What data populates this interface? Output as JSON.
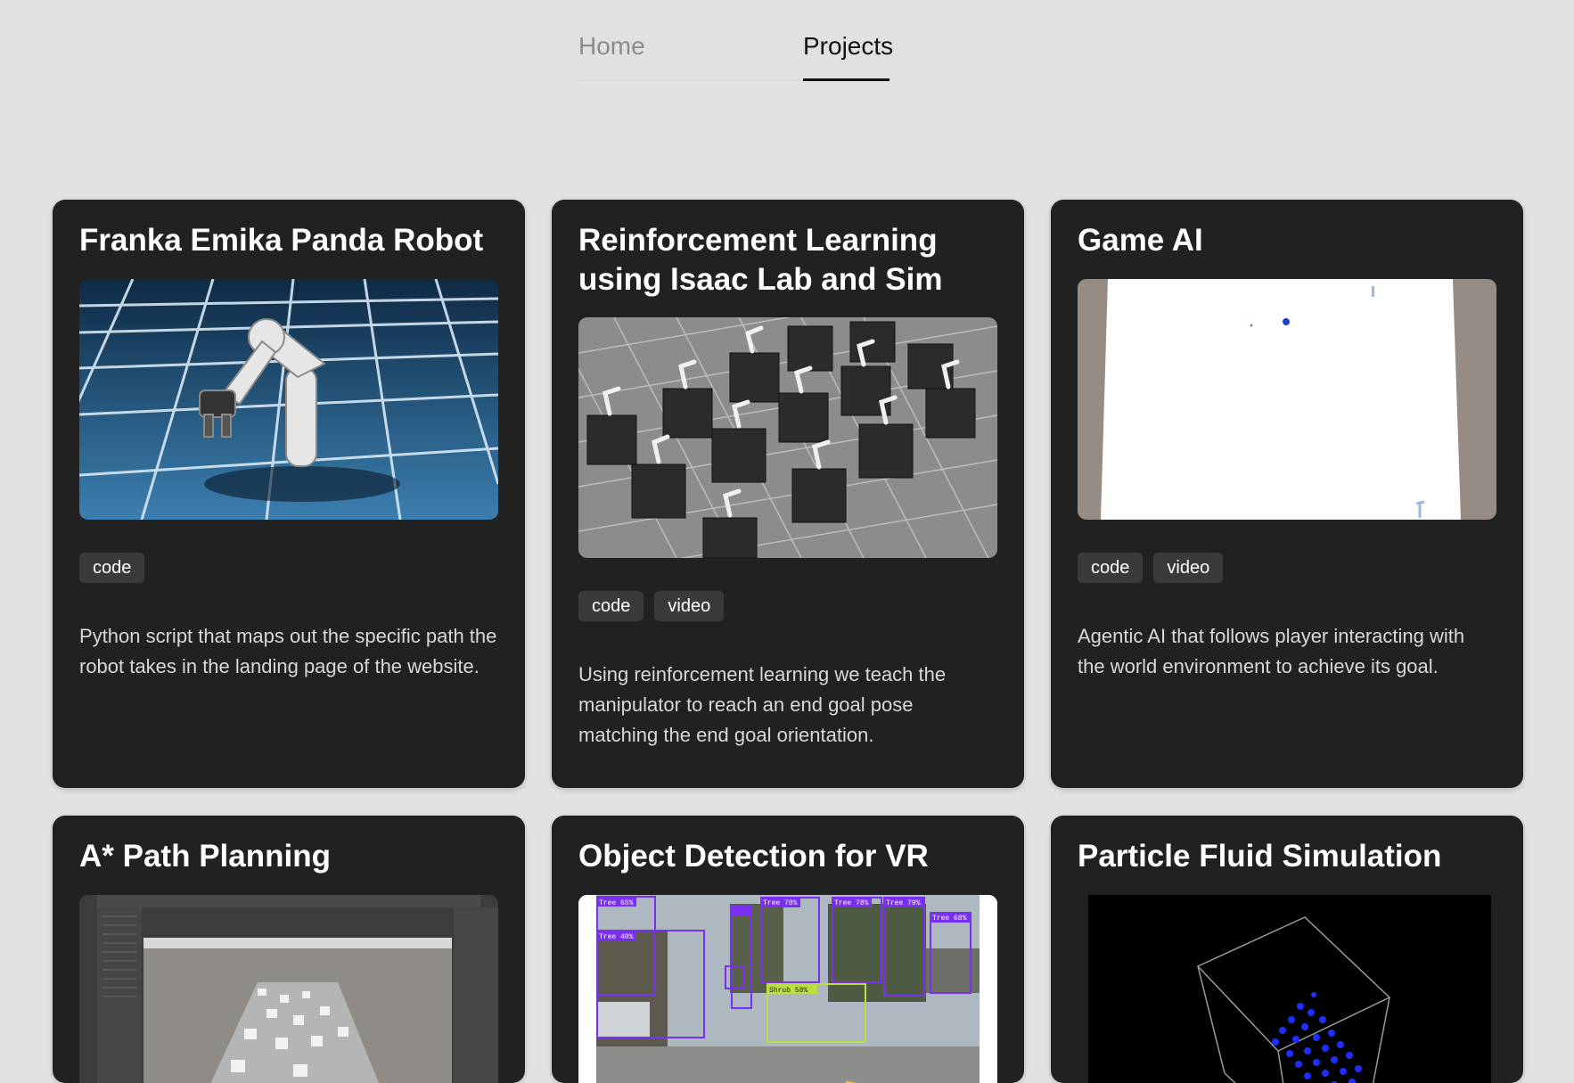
{
  "nav": {
    "home_label": "Home",
    "projects_label": "Projects"
  },
  "colors": {
    "page_bg": "#e1e1e1",
    "card_bg": "#212121",
    "tag_bg": "#3a3a3a"
  },
  "projects": [
    {
      "title": "Franka Emika Panda Robot",
      "image_icon": "robot-arm-grid-image",
      "tags": [
        "code"
      ],
      "description": "Python script that maps out the specific path the robot takes in the landing page of the website."
    },
    {
      "title": "Reinforcement Learning using Isaac Lab and Sim",
      "image_icon": "multi-robot-sim-image",
      "tags": [
        "code",
        "video"
      ],
      "description": "Using reinforcement learning we teach the manipulator to reach an end goal pose matching the end goal orientation."
    },
    {
      "title": "Game AI",
      "image_icon": "game-ai-map-image",
      "tags": [
        "code",
        "video"
      ],
      "description": "Agentic AI that follows player interacting with the world environment to achieve its goal."
    },
    {
      "title": "A* Path Planning",
      "image_icon": "unity-editor-image"
    },
    {
      "title": "Object Detection for VR",
      "image_icon": "street-detection-image",
      "detection_labels": [
        "Tree 65%",
        "Tree 40%",
        "Tree 70%",
        "Tree 78%",
        "Tree 79%",
        "Tree 68%",
        "Shrub 58%"
      ]
    },
    {
      "title": "Particle Fluid Simulation",
      "image_icon": "particle-cube-image"
    }
  ]
}
